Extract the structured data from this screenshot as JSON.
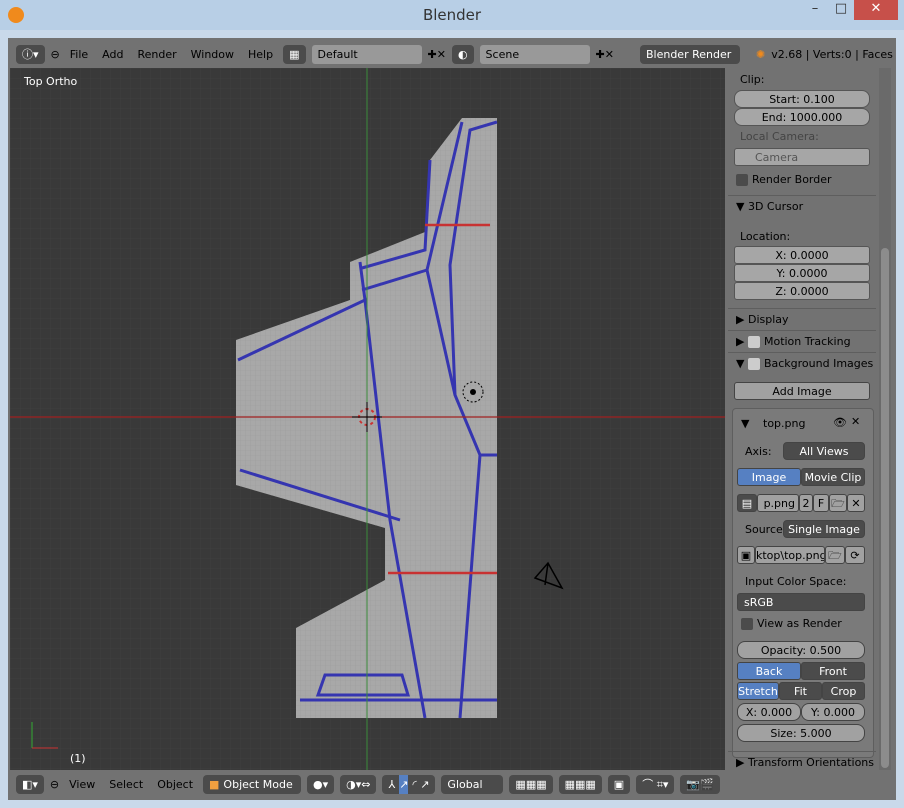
{
  "window": {
    "title": "Blender",
    "min": "–",
    "max": "□",
    "close": "✕"
  },
  "top_header": {
    "menus": [
      "File",
      "Add",
      "Render",
      "Window",
      "Help"
    ],
    "screen": "Default",
    "scene": "Scene",
    "engine": "Blender Render",
    "stats": "v2.68 | Verts:0 | Faces"
  },
  "viewport": {
    "label": "Top Ortho",
    "frame": "(1)",
    "colors": {
      "background": "#393939",
      "x_axis": "#a02020",
      "y_axis": "#3a8a3a",
      "image": "#a8a8a8",
      "lines": "#3535b0"
    }
  },
  "panel": {
    "clip_label": "Clip:",
    "start": "Start: 0.100",
    "end": "End: 1000.000",
    "local_camera": "Local Camera:",
    "camera": "Camera",
    "render_border": "Render Border",
    "cursor_section": "3D Cursor",
    "location": "Location:",
    "x": "X: 0.0000",
    "y": "Y: 0.0000",
    "z": "Z: 0.0000",
    "display": "Display",
    "motion_tracking": "Motion Tracking",
    "background_images": "Background Images",
    "add_image": "Add Image",
    "image_name": "top.png",
    "axis_label": "Axis:",
    "axis_value": "All Views",
    "tab_image": "Image",
    "tab_movie": "Movie Clip",
    "file_short": "p.png",
    "users": "2",
    "fake": "F",
    "source_label": "Source",
    "source_value": "Single Image",
    "path": "ktop\\top.png",
    "colorspace_label": "Input Color Space:",
    "colorspace": "sRGB",
    "view_as_render": "View as Render",
    "opacity": "Opacity: 0.500",
    "back": "Back",
    "front": "Front",
    "stretch": "Stretch",
    "fit": "Fit",
    "crop": "Crop",
    "offx": "X: 0.000",
    "offy": "Y: 0.000",
    "size": "Size: 5.000",
    "transform_orientations": "Transform Orientations"
  },
  "bottom_header": {
    "menus": [
      "View",
      "Select",
      "Object"
    ],
    "mode": "Object Mode",
    "orientation": "Global"
  }
}
